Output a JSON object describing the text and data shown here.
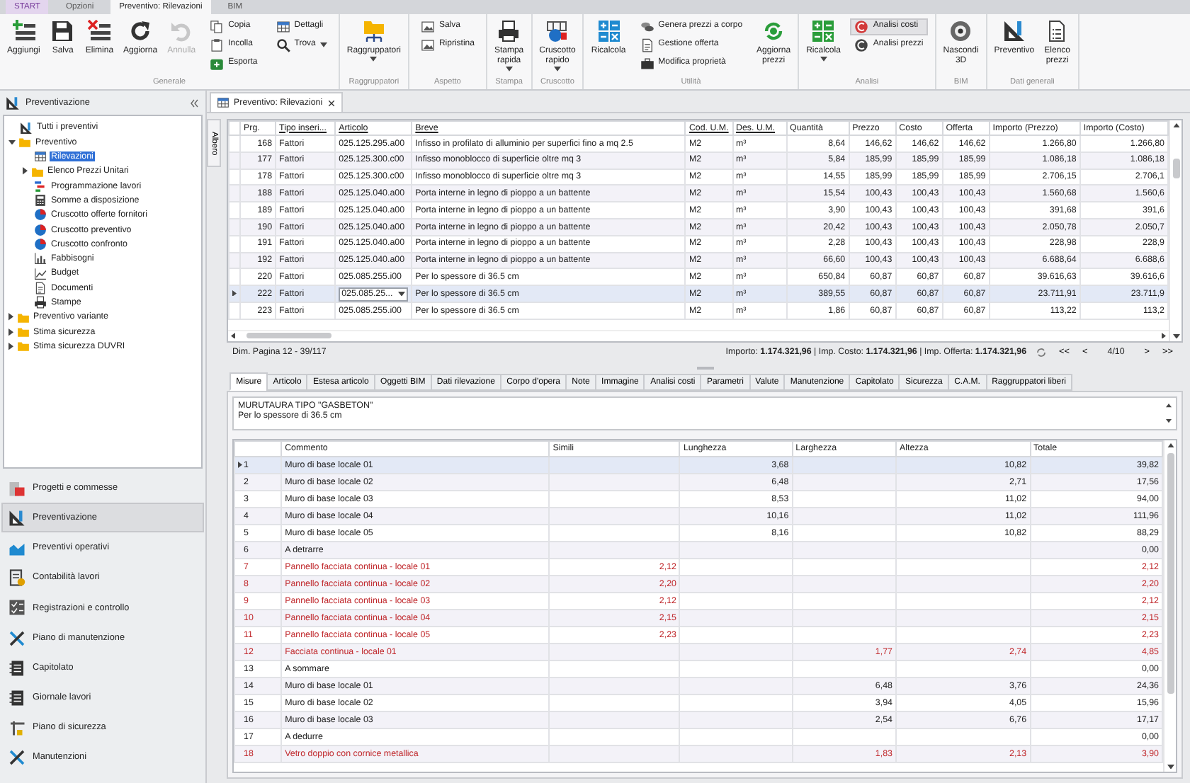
{
  "app_tabs": [
    {
      "label": "START",
      "kind": "application",
      "selected": false
    },
    {
      "label": "Opzioni",
      "kind": "tab",
      "selected": false
    },
    {
      "label": "Preventivo: Rilevazioni",
      "kind": "tab",
      "selected": true
    },
    {
      "label": "BIM",
      "kind": "tab",
      "selected": false
    }
  ],
  "ribbon": {
    "groups": [
      {
        "label": "Generale",
        "items": [
          {
            "kind": "large",
            "label": "Aggiungi",
            "disabled": false,
            "dropdown": false
          },
          {
            "kind": "large",
            "label": "Salva",
            "disabled": false,
            "dropdown": false
          },
          {
            "kind": "large",
            "label": "Elimina",
            "disabled": false,
            "dropdown": false
          },
          {
            "kind": "large",
            "label": "Aggiorna",
            "disabled": false,
            "dropdown": false
          },
          {
            "kind": "large",
            "label": "Annulla",
            "disabled": true,
            "dropdown": false
          },
          {
            "kind": "stack",
            "items": [
              {
                "label": "Copia"
              },
              {
                "label": "Incolla"
              },
              {
                "label": "Esporta"
              }
            ]
          },
          {
            "kind": "stack",
            "items": [
              {
                "label": "Dettagli",
                "dropdown": false
              },
              {
                "label": "Trova",
                "dropdown": true
              }
            ]
          }
        ]
      },
      {
        "label": "Raggruppatori",
        "items": [
          {
            "kind": "large",
            "label": "Raggruppatori",
            "disabled": false,
            "dropdown": true
          }
        ]
      },
      {
        "label": "Aspetto",
        "items": [
          {
            "kind": "stack",
            "items": [
              {
                "label": "Salva"
              },
              {
                "label": "Ripristina"
              }
            ]
          }
        ]
      },
      {
        "label": "Stampa",
        "items": [
          {
            "kind": "large",
            "label": "Stampa rapida",
            "disabled": false,
            "dropdown": true
          }
        ]
      },
      {
        "label": "Cruscotto",
        "items": [
          {
            "kind": "large",
            "label": "Cruscotto rapido",
            "disabled": false,
            "dropdown": true
          }
        ]
      },
      {
        "label": "Utilità",
        "items": [
          {
            "kind": "large",
            "label": "Ricalcola",
            "disabled": false,
            "dropdown": false
          },
          {
            "kind": "stack",
            "items": [
              {
                "label": "Genera prezzi a corpo"
              },
              {
                "label": "Gestione offerta"
              },
              {
                "label": "Modifica proprietà"
              }
            ]
          },
          {
            "kind": "large",
            "label": "Aggiorna prezzi",
            "disabled": false,
            "dropdown": false
          }
        ]
      },
      {
        "label": "Analisi",
        "items": [
          {
            "kind": "large",
            "label": "Ricalcola",
            "disabled": false,
            "dropdown": true
          },
          {
            "kind": "stack",
            "items": [
              {
                "label": "Analisi costi",
                "selected": true
              },
              {
                "label": "Analisi prezzi",
                "selected": false
              }
            ]
          }
        ]
      },
      {
        "label": "BIM",
        "items": [
          {
            "kind": "large",
            "label": "Nascondi 3D",
            "disabled": false,
            "dropdown": false
          }
        ]
      },
      {
        "label": "Dati generali",
        "items": [
          {
            "kind": "large",
            "label": "Preventivo",
            "disabled": false,
            "dropdown": false
          },
          {
            "kind": "large",
            "label": "Elenco prezzi",
            "disabled": false,
            "dropdown": false
          }
        ]
      }
    ]
  },
  "navigator": {
    "title": "Preventivazione",
    "tree": [
      {
        "label": "Tutti i preventivi",
        "selected": false
      },
      {
        "label": "Preventivo",
        "selected": false,
        "expanded": true,
        "children": [
          {
            "label": "Rilevazioni",
            "selected": true
          },
          {
            "label": "Elenco Prezzi Unitari",
            "selected": false,
            "expanded": false
          },
          {
            "label": "Programmazione lavori",
            "selected": false
          },
          {
            "label": "Somme a disposizione",
            "selected": false
          },
          {
            "label": "Cruscotto offerte fornitori",
            "selected": false
          },
          {
            "label": "Cruscotto preventivo",
            "selected": false
          },
          {
            "label": "Cruscotto confronto",
            "selected": false
          },
          {
            "label": "Fabbisogni",
            "selected": false
          },
          {
            "label": "Budget",
            "selected": false
          },
          {
            "label": "Documenti",
            "selected": false
          },
          {
            "label": "Stampe",
            "selected": false
          }
        ]
      },
      {
        "label": "Preventivo variante",
        "selected": false,
        "expanded": false
      },
      {
        "label": "Stima sicurezza",
        "selected": false,
        "expanded": false
      },
      {
        "label": "Stima sicurezza DUVRI",
        "selected": false,
        "expanded": false
      }
    ]
  },
  "modules": [
    {
      "label": "Progetti e commesse",
      "selected": false
    },
    {
      "label": "Preventivazione",
      "selected": true
    },
    {
      "label": "Preventivi operativi",
      "selected": false
    },
    {
      "label": "Contabilità lavori",
      "selected": false
    },
    {
      "label": "Registrazioni e controllo",
      "selected": false
    },
    {
      "label": "Piano di manutenzione",
      "selected": false
    },
    {
      "label": "Capitolato",
      "selected": false
    },
    {
      "label": "Giornale lavori",
      "selected": false
    },
    {
      "label": "Piano di sicurezza",
      "selected": false
    },
    {
      "label": "Manutenzioni",
      "selected": false
    }
  ],
  "document_tab": {
    "label": "Preventivo: Rilevazioni"
  },
  "side_tab": {
    "label": "Albero"
  },
  "rilevazioni": {
    "columns": [
      {
        "label": "Prg.",
        "underlined": false
      },
      {
        "label": "Tipo inseri...",
        "underlined": true
      },
      {
        "label": "Articolo",
        "underlined": true
      },
      {
        "label": "Breve",
        "underlined": true
      },
      {
        "label": "Cod. U.M.",
        "underlined": true
      },
      {
        "label": "Des. U.M.",
        "underlined": true
      },
      {
        "label": "Quantità",
        "underlined": false
      },
      {
        "label": "Prezzo",
        "underlined": false
      },
      {
        "label": "Costo",
        "underlined": false
      },
      {
        "label": "Offerta",
        "underlined": false
      },
      {
        "label": "Importo (Prezzo)",
        "underlined": false
      },
      {
        "label": "Importo (Costo)",
        "underlined": false
      }
    ],
    "rows": [
      {
        "selected": false,
        "cells": [
          "168",
          "Fattori",
          "025.125.295.a00",
          "Infisso in profilato di alluminio per superfici fino a mq 2.5",
          "M2",
          "m³",
          "8,64",
          "146,62",
          "146,62",
          "146,62",
          "1.266,80",
          "1.266,80"
        ]
      },
      {
        "selected": false,
        "cells": [
          "177",
          "Fattori",
          "025.125.300.c00",
          "Infisso monoblocco di superficie oltre mq 3",
          "M2",
          "m³",
          "5,84",
          "185,99",
          "185,99",
          "185,99",
          "1.086,18",
          "1.086,18"
        ]
      },
      {
        "selected": false,
        "cells": [
          "178",
          "Fattori",
          "025.125.300.c00",
          "Infisso monoblocco di superficie oltre mq 3",
          "M2",
          "m³",
          "14,55",
          "185,99",
          "185,99",
          "185,99",
          "2.706,15",
          "2.706,1"
        ]
      },
      {
        "selected": false,
        "cells": [
          "188",
          "Fattori",
          "025.125.040.a00",
          "Porta interne in legno di pioppo a un battente",
          "M2",
          "m³",
          "15,54",
          "100,43",
          "100,43",
          "100,43",
          "1.560,68",
          "1.560,6"
        ]
      },
      {
        "selected": false,
        "cells": [
          "189",
          "Fattori",
          "025.125.040.a00",
          "Porta interne in legno di pioppo a un battente",
          "M2",
          "m³",
          "3,90",
          "100,43",
          "100,43",
          "100,43",
          "391,68",
          "391,6"
        ]
      },
      {
        "selected": false,
        "cells": [
          "190",
          "Fattori",
          "025.125.040.a00",
          "Porta interne in legno di pioppo a un battente",
          "M2",
          "m³",
          "20,42",
          "100,43",
          "100,43",
          "100,43",
          "2.050,78",
          "2.050,7"
        ]
      },
      {
        "selected": false,
        "cells": [
          "191",
          "Fattori",
          "025.125.040.a00",
          "Porta interne in legno di pioppo a un battente",
          "M2",
          "m³",
          "2,28",
          "100,43",
          "100,43",
          "100,43",
          "228,98",
          "228,9"
        ]
      },
      {
        "selected": false,
        "cells": [
          "192",
          "Fattori",
          "025.125.040.a00",
          "Porta interne in legno di pioppo a un battente",
          "M2",
          "m³",
          "66,60",
          "100,43",
          "100,43",
          "100,43",
          "6.688,64",
          "6.688,6"
        ]
      },
      {
        "selected": false,
        "cells": [
          "220",
          "Fattori",
          "025.085.255.i00",
          "Per lo spessore di 36.5 cm",
          "M2",
          "m³",
          "650,84",
          "60,87",
          "60,87",
          "60,87",
          "39.616,63",
          "39.616,6"
        ]
      },
      {
        "selected": true,
        "cells": [
          "222",
          "Fattori",
          "025.085.25...",
          "Per lo spessore di 36.5 cm",
          "M2",
          "m³",
          "389,55",
          "60,87",
          "60,87",
          "60,87",
          "23.711,91",
          "23.711,9"
        ]
      },
      {
        "selected": false,
        "cells": [
          "223",
          "Fattori",
          "025.085.255.i00",
          "Per lo spessore di 36.5 cm",
          "M2",
          "m³",
          "1,86",
          "60,87",
          "60,87",
          "60,87",
          "113,22",
          "113,2"
        ]
      }
    ]
  },
  "status": {
    "page_info": "Dim. Pagina 12 - 39/117",
    "totals": "Importo: **1.174.321,96** | Imp. Costo: **1.174.321,96** | Imp. Offerta: **1.174.321,96**",
    "pager": {
      "first": "<<",
      "previous": "<",
      "page": "4/10",
      "next": ">",
      "last": ">>"
    }
  },
  "detail_tabs": [
    {
      "label": "Misure",
      "selected": true
    },
    {
      "label": "Articolo",
      "selected": false
    },
    {
      "label": "Estesa articolo",
      "selected": false
    },
    {
      "label": "Oggetti BIM",
      "selected": false
    },
    {
      "label": "Dati rilevazione",
      "selected": false
    },
    {
      "label": "Corpo d'opera",
      "selected": false
    },
    {
      "label": "Note",
      "selected": false
    },
    {
      "label": "Immagine",
      "selected": false
    },
    {
      "label": "Analisi costi",
      "selected": false
    },
    {
      "label": "Parametri",
      "selected": false
    },
    {
      "label": "Valute",
      "selected": false
    },
    {
      "label": "Manutenzione",
      "selected": false
    },
    {
      "label": "Capitolato",
      "selected": false
    },
    {
      "label": "Sicurezza",
      "selected": false
    },
    {
      "label": "C.A.M.",
      "selected": false
    },
    {
      "label": "Raggruppatori liberi",
      "selected": false
    }
  ],
  "description": [
    "MURUTAURA TIPO \"GASBETON\"",
    "Per lo spessore di 36.5 cm"
  ],
  "misure": {
    "columns": [
      "Commento",
      "Simili",
      "Lunghezza",
      "Larghezza",
      "Altezza",
      "Totale"
    ],
    "rows": [
      {
        "n": "1",
        "selected": true,
        "deduction": false,
        "commento": "Muro di base locale 01",
        "lunghezza": "3,68",
        "altezza": "10,82",
        "totale": "39,82"
      },
      {
        "n": "2",
        "selected": false,
        "deduction": false,
        "commento": "Muro di base locale 02",
        "lunghezza": "6,48",
        "altezza": "2,71",
        "totale": "17,56"
      },
      {
        "n": "3",
        "selected": false,
        "deduction": false,
        "commento": "Muro di base locale 03",
        "lunghezza": "8,53",
        "altezza": "11,02",
        "totale": "94,00"
      },
      {
        "n": "4",
        "selected": false,
        "deduction": false,
        "commento": "Muro di base locale 04",
        "lunghezza": "10,16",
        "altezza": "11,02",
        "totale": "111,96"
      },
      {
        "n": "5",
        "selected": false,
        "deduction": false,
        "commento": "Muro di base locale 05",
        "lunghezza": "8,16",
        "altezza": "10,82",
        "totale": "88,29"
      },
      {
        "n": "6",
        "selected": false,
        "deduction": false,
        "commento": "A detrarre",
        "totale": "0,00"
      },
      {
        "n": "7",
        "selected": false,
        "deduction": true,
        "commento": "Pannello facciata continua - locale 01",
        "simili": "2,12",
        "totale": "2,12"
      },
      {
        "n": "8",
        "selected": false,
        "deduction": true,
        "commento": "Pannello facciata continua - locale 02",
        "simili": "2,20",
        "totale": "2,20"
      },
      {
        "n": "9",
        "selected": false,
        "deduction": true,
        "commento": "Pannello facciata continua - locale 03",
        "simili": "2,12",
        "totale": "2,12"
      },
      {
        "n": "10",
        "selected": false,
        "deduction": true,
        "commento": "Pannello facciata continua - locale 04",
        "simili": "2,15",
        "totale": "2,15"
      },
      {
        "n": "11",
        "selected": false,
        "deduction": true,
        "commento": "Pannello facciata continua - locale 05",
        "simili": "2,23",
        "totale": "2,23"
      },
      {
        "n": "12",
        "selected": false,
        "deduction": true,
        "commento": "Facciata continua - locale 01",
        "larghezza": "1,77",
        "altezza": "2,74",
        "totale": "4,85"
      },
      {
        "n": "13",
        "selected": false,
        "deduction": false,
        "commento": "A sommare",
        "totale": "0,00"
      },
      {
        "n": "14",
        "selected": false,
        "deduction": false,
        "commento": "Muro di base locale 01",
        "larghezza": "6,48",
        "altezza": "3,76",
        "totale": "24,36"
      },
      {
        "n": "15",
        "selected": false,
        "deduction": false,
        "commento": "Muro di base locale 02",
        "larghezza": "3,94",
        "altezza": "4,05",
        "totale": "15,96"
      },
      {
        "n": "16",
        "selected": false,
        "deduction": false,
        "commento": "Muro di base locale 03",
        "larghezza": "2,54",
        "altezza": "6,76",
        "totale": "17,17"
      },
      {
        "n": "17",
        "selected": false,
        "deduction": false,
        "commento": "A dedurre",
        "totale": "0,00"
      },
      {
        "n": "18",
        "selected": false,
        "deduction": true,
        "commento": "Vetro doppio con cornice metallica",
        "larghezza": "1,83",
        "altezza": "2,13",
        "totale": "3,90"
      }
    ]
  }
}
